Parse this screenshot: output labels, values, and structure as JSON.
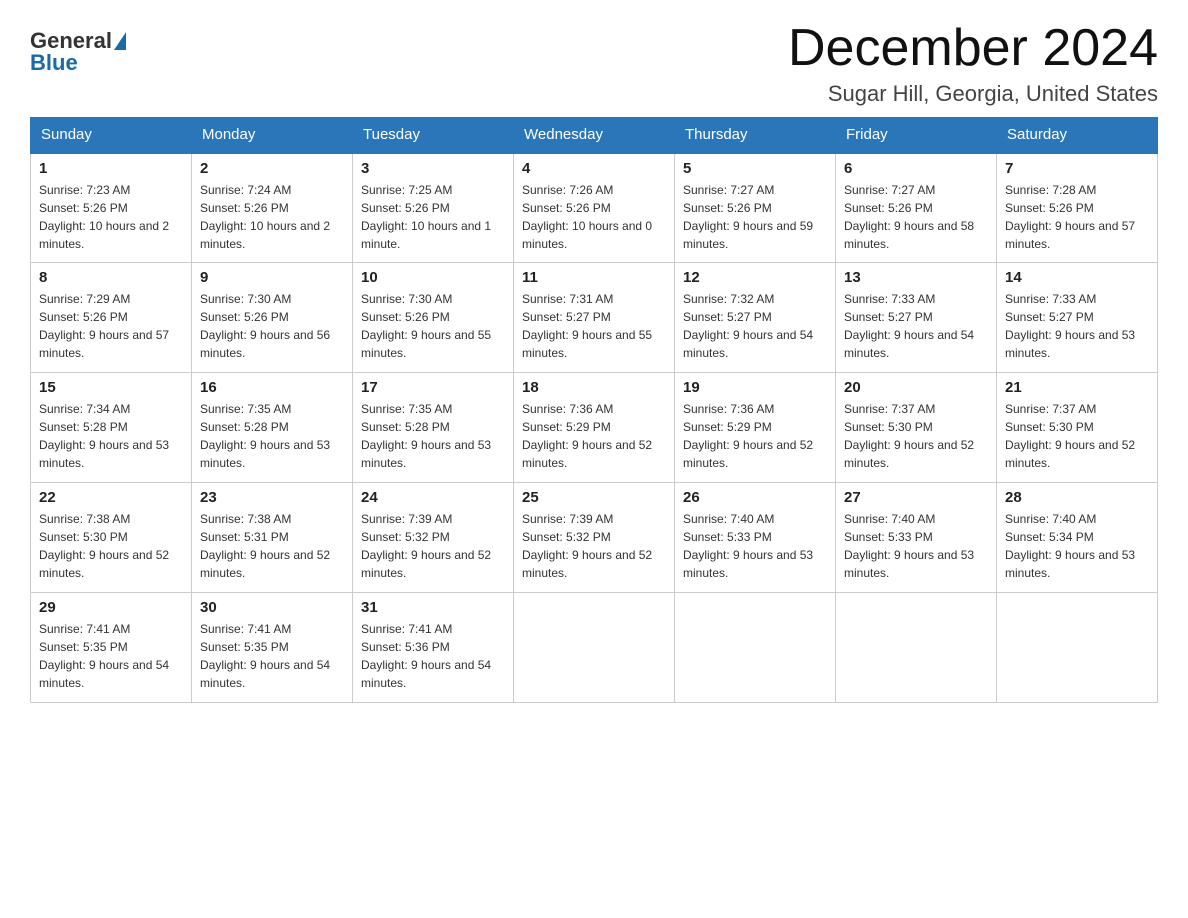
{
  "header": {
    "logo_general": "General",
    "logo_blue": "Blue",
    "month_title": "December 2024",
    "location": "Sugar Hill, Georgia, United States"
  },
  "days_of_week": [
    "Sunday",
    "Monday",
    "Tuesday",
    "Wednesday",
    "Thursday",
    "Friday",
    "Saturday"
  ],
  "weeks": [
    [
      {
        "day": "1",
        "sunrise": "7:23 AM",
        "sunset": "5:26 PM",
        "daylight": "10 hours and 2 minutes."
      },
      {
        "day": "2",
        "sunrise": "7:24 AM",
        "sunset": "5:26 PM",
        "daylight": "10 hours and 2 minutes."
      },
      {
        "day": "3",
        "sunrise": "7:25 AM",
        "sunset": "5:26 PM",
        "daylight": "10 hours and 1 minute."
      },
      {
        "day": "4",
        "sunrise": "7:26 AM",
        "sunset": "5:26 PM",
        "daylight": "10 hours and 0 minutes."
      },
      {
        "day": "5",
        "sunrise": "7:27 AM",
        "sunset": "5:26 PM",
        "daylight": "9 hours and 59 minutes."
      },
      {
        "day": "6",
        "sunrise": "7:27 AM",
        "sunset": "5:26 PM",
        "daylight": "9 hours and 58 minutes."
      },
      {
        "day": "7",
        "sunrise": "7:28 AM",
        "sunset": "5:26 PM",
        "daylight": "9 hours and 57 minutes."
      }
    ],
    [
      {
        "day": "8",
        "sunrise": "7:29 AM",
        "sunset": "5:26 PM",
        "daylight": "9 hours and 57 minutes."
      },
      {
        "day": "9",
        "sunrise": "7:30 AM",
        "sunset": "5:26 PM",
        "daylight": "9 hours and 56 minutes."
      },
      {
        "day": "10",
        "sunrise": "7:30 AM",
        "sunset": "5:26 PM",
        "daylight": "9 hours and 55 minutes."
      },
      {
        "day": "11",
        "sunrise": "7:31 AM",
        "sunset": "5:27 PM",
        "daylight": "9 hours and 55 minutes."
      },
      {
        "day": "12",
        "sunrise": "7:32 AM",
        "sunset": "5:27 PM",
        "daylight": "9 hours and 54 minutes."
      },
      {
        "day": "13",
        "sunrise": "7:33 AM",
        "sunset": "5:27 PM",
        "daylight": "9 hours and 54 minutes."
      },
      {
        "day": "14",
        "sunrise": "7:33 AM",
        "sunset": "5:27 PM",
        "daylight": "9 hours and 53 minutes."
      }
    ],
    [
      {
        "day": "15",
        "sunrise": "7:34 AM",
        "sunset": "5:28 PM",
        "daylight": "9 hours and 53 minutes."
      },
      {
        "day": "16",
        "sunrise": "7:35 AM",
        "sunset": "5:28 PM",
        "daylight": "9 hours and 53 minutes."
      },
      {
        "day": "17",
        "sunrise": "7:35 AM",
        "sunset": "5:28 PM",
        "daylight": "9 hours and 53 minutes."
      },
      {
        "day": "18",
        "sunrise": "7:36 AM",
        "sunset": "5:29 PM",
        "daylight": "9 hours and 52 minutes."
      },
      {
        "day": "19",
        "sunrise": "7:36 AM",
        "sunset": "5:29 PM",
        "daylight": "9 hours and 52 minutes."
      },
      {
        "day": "20",
        "sunrise": "7:37 AM",
        "sunset": "5:30 PM",
        "daylight": "9 hours and 52 minutes."
      },
      {
        "day": "21",
        "sunrise": "7:37 AM",
        "sunset": "5:30 PM",
        "daylight": "9 hours and 52 minutes."
      }
    ],
    [
      {
        "day": "22",
        "sunrise": "7:38 AM",
        "sunset": "5:30 PM",
        "daylight": "9 hours and 52 minutes."
      },
      {
        "day": "23",
        "sunrise": "7:38 AM",
        "sunset": "5:31 PM",
        "daylight": "9 hours and 52 minutes."
      },
      {
        "day": "24",
        "sunrise": "7:39 AM",
        "sunset": "5:32 PM",
        "daylight": "9 hours and 52 minutes."
      },
      {
        "day": "25",
        "sunrise": "7:39 AM",
        "sunset": "5:32 PM",
        "daylight": "9 hours and 52 minutes."
      },
      {
        "day": "26",
        "sunrise": "7:40 AM",
        "sunset": "5:33 PM",
        "daylight": "9 hours and 53 minutes."
      },
      {
        "day": "27",
        "sunrise": "7:40 AM",
        "sunset": "5:33 PM",
        "daylight": "9 hours and 53 minutes."
      },
      {
        "day": "28",
        "sunrise": "7:40 AM",
        "sunset": "5:34 PM",
        "daylight": "9 hours and 53 minutes."
      }
    ],
    [
      {
        "day": "29",
        "sunrise": "7:41 AM",
        "sunset": "5:35 PM",
        "daylight": "9 hours and 54 minutes."
      },
      {
        "day": "30",
        "sunrise": "7:41 AM",
        "sunset": "5:35 PM",
        "daylight": "9 hours and 54 minutes."
      },
      {
        "day": "31",
        "sunrise": "7:41 AM",
        "sunset": "5:36 PM",
        "daylight": "9 hours and 54 minutes."
      },
      null,
      null,
      null,
      null
    ]
  ],
  "labels": {
    "sunrise": "Sunrise:",
    "sunset": "Sunset:",
    "daylight": "Daylight:"
  }
}
